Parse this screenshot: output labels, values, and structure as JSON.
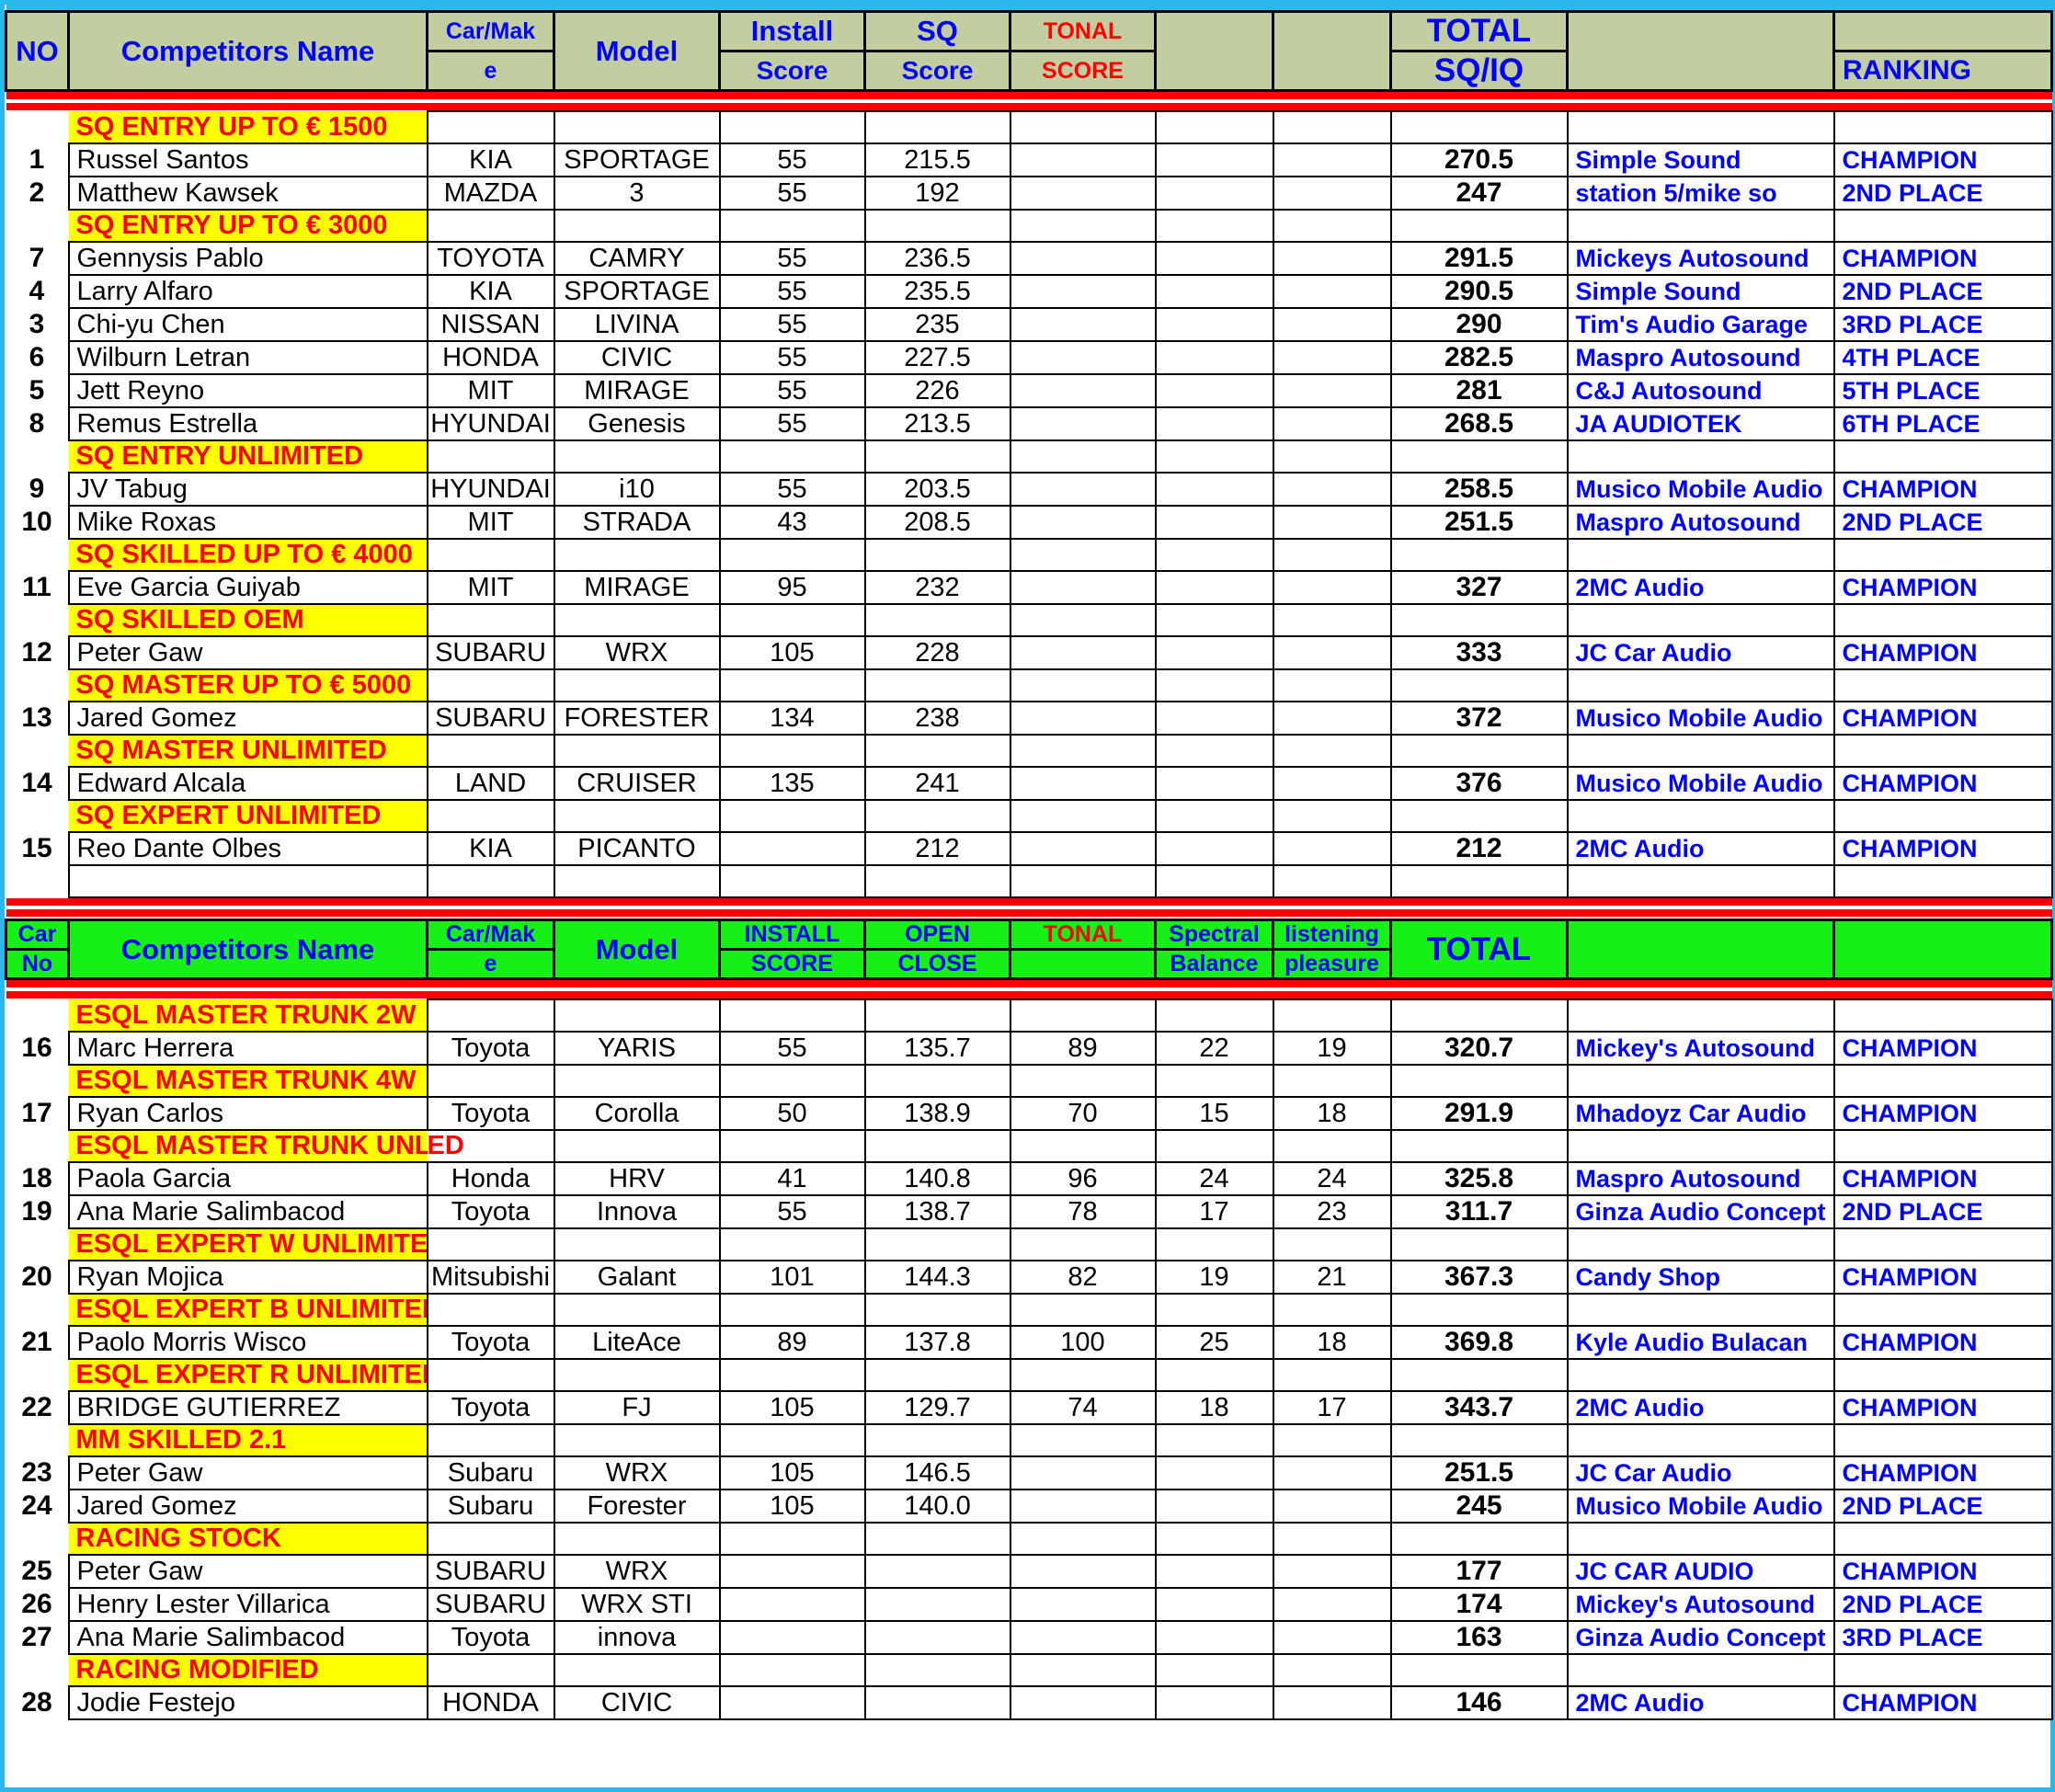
{
  "colors": {
    "sq_header_bg": "#c3cea0",
    "esql_header_bg": "#16f016",
    "category_bg": "#ffff00",
    "category_text": "#ff0000",
    "header_text": "#0000ff",
    "shop_text": "#0000ff",
    "rule": "#ff0000",
    "page_border": "#2bb8ea"
  },
  "sq_table": {
    "header": {
      "no": "NO",
      "name": "Competitors Name",
      "make_line1": "Car/Mak",
      "make_line2": "e",
      "model": "Model",
      "install_line1": "Install",
      "install_line2": "Score",
      "sq_line1": "SQ",
      "sq_line2": "Score",
      "tonal_line1": "TONAL",
      "tonal_line2": "SCORE",
      "extra1": "",
      "extra2": "",
      "total_line1": "TOTAL",
      "total_line2": "SQ/IQ",
      "shop": "",
      "ranking": "RANKING"
    },
    "rows": [
      {
        "kind": "category",
        "label": "SQ ENTRY  UP TO  € 1500"
      },
      {
        "kind": "data",
        "no": "1",
        "name": "Russel Santos",
        "make": "KIA",
        "model": "SPORTAGE",
        "install": "55",
        "sq": "215.5",
        "tonal": "",
        "x1": "",
        "x2": "",
        "total": "270.5",
        "shop": "Simple Sound",
        "rank": "CHAMPION"
      },
      {
        "kind": "data",
        "no": "2",
        "name": "Matthew Kawsek",
        "make": "MAZDA",
        "model": "3",
        "install": "55",
        "sq": "192",
        "tonal": "",
        "x1": "",
        "x2": "",
        "total": "247",
        "shop": "station 5/mike so",
        "rank": "2ND PLACE"
      },
      {
        "kind": "category",
        "label": "SQ ENTRY  UP TO  € 3000"
      },
      {
        "kind": "data",
        "no": "7",
        "name": "Gennysis Pablo",
        "make": "TOYOTA",
        "model": "CAMRY",
        "install": "55",
        "sq": "236.5",
        "tonal": "",
        "x1": "",
        "x2": "",
        "total": "291.5",
        "shop": "Mickeys Autosound",
        "rank": "CHAMPION"
      },
      {
        "kind": "data",
        "no": "4",
        "name": "Larry Alfaro",
        "make": "KIA",
        "model": "SPORTAGE",
        "install": "55",
        "sq": "235.5",
        "tonal": "",
        "x1": "",
        "x2": "",
        "total": "290.5",
        "shop": "Simple Sound",
        "rank": "2ND PLACE"
      },
      {
        "kind": "data",
        "no": "3",
        "name": "Chi-yu Chen",
        "make": "NISSAN",
        "model": "LIVINA",
        "install": "55",
        "sq": "235",
        "tonal": "",
        "x1": "",
        "x2": "",
        "total": "290",
        "shop": "Tim's Audio Garage",
        "rank": "3RD PLACE"
      },
      {
        "kind": "data",
        "no": "6",
        "name": "Wilburn Letran",
        "make": "HONDA",
        "model": "CIVIC",
        "install": "55",
        "sq": "227.5",
        "tonal": "",
        "x1": "",
        "x2": "",
        "total": "282.5",
        "shop": "Maspro Autosound",
        "rank": "4TH PLACE"
      },
      {
        "kind": "data",
        "no": "5",
        "name": "Jett Reyno",
        "make": "MIT",
        "model": "MIRAGE",
        "install": "55",
        "sq": "226",
        "tonal": "",
        "x1": "",
        "x2": "",
        "total": "281",
        "shop": "C&J Autosound",
        "rank": "5TH PLACE"
      },
      {
        "kind": "data",
        "no": "8",
        "name": "Remus Estrella",
        "make": "HYUNDAI",
        "model": "Genesis",
        "install": "55",
        "sq": "213.5",
        "tonal": "",
        "x1": "",
        "x2": "",
        "total": "268.5",
        "shop": "JA AUDIOTEK",
        "rank": "6TH PLACE"
      },
      {
        "kind": "category",
        "label": "SQ ENTRY  UNLIMITED"
      },
      {
        "kind": "data",
        "no": "9",
        "name": "JV Tabug",
        "make": "HYUNDAI",
        "model": "i10",
        "install": "55",
        "sq": "203.5",
        "tonal": "",
        "x1": "",
        "x2": "",
        "total": "258.5",
        "shop": "Musico Mobile Audio",
        "rank": "CHAMPION"
      },
      {
        "kind": "data",
        "no": "10",
        "name": "Mike Roxas",
        "make": "MIT",
        "model": "STRADA",
        "install": "43",
        "sq": "208.5",
        "tonal": "",
        "x1": "",
        "x2": "",
        "total": "251.5",
        "shop": "Maspro Autosound",
        "rank": "2ND PLACE"
      },
      {
        "kind": "category",
        "label": "SQ SKILLED  UP TO  € 4000"
      },
      {
        "kind": "data",
        "no": "11",
        "name": "Eve Garcia Guiyab",
        "make": "MIT",
        "model": "MIRAGE",
        "install": "95",
        "sq": "232",
        "tonal": "",
        "x1": "",
        "x2": "",
        "total": "327",
        "shop": "2MC Audio",
        "rank": "CHAMPION"
      },
      {
        "kind": "category",
        "label": "SQ SKILLED  OEM"
      },
      {
        "kind": "data",
        "no": "12",
        "name": "Peter Gaw",
        "make": "SUBARU",
        "model": "WRX",
        "install": "105",
        "sq": "228",
        "tonal": "",
        "x1": "",
        "x2": "",
        "total": "333",
        "shop": "JC Car Audio",
        "rank": "CHAMPION"
      },
      {
        "kind": "category",
        "label": "SQ MASTER UP TO € 5000"
      },
      {
        "kind": "data",
        "no": "13",
        "name": "Jared Gomez",
        "make": "SUBARU",
        "model": "FORESTER",
        "install": "134",
        "sq": "238",
        "tonal": "",
        "x1": "",
        "x2": "",
        "total": "372",
        "shop": "Musico Mobile Audio",
        "rank": "CHAMPION"
      },
      {
        "kind": "category",
        "label": "SQ MASTER  UNLIMITED"
      },
      {
        "kind": "data",
        "no": "14",
        "name": "Edward Alcala",
        "make": "LAND",
        "model": "CRUISER",
        "install": "135",
        "sq": "241",
        "tonal": "",
        "x1": "",
        "x2": "",
        "total": "376",
        "shop": "Musico Mobile Audio",
        "rank": "CHAMPION"
      },
      {
        "kind": "category",
        "label": "SQ EXPERT UNLIMITED"
      },
      {
        "kind": "data",
        "no": "15",
        "name": "Reo Dante Olbes",
        "make": "KIA",
        "model": "PICANTO",
        "install": "",
        "sq": "212",
        "tonal": "",
        "x1": "",
        "x2": "",
        "total": "212",
        "shop": "2MC Audio",
        "rank": "CHAMPION"
      },
      {
        "kind": "spacer"
      }
    ]
  },
  "esql_table": {
    "header": {
      "no_line1": "Car",
      "no_line2": "No",
      "name": "Competitors Name",
      "make_line1": "Car/Mak",
      "make_line2": "e",
      "model": "Model",
      "install_line1": "INSTALL",
      "install_line2": "SCORE",
      "open_line1": "OPEN",
      "open_line2": "CLOSE",
      "tonal_line1": "TONAL",
      "tonal_line2": "",
      "spectral_line1": "Spectral",
      "spectral_line2": "Balance",
      "listening_line1": "listening",
      "listening_line2": "pleasure",
      "total": "TOTAL",
      "shop": "",
      "ranking": ""
    },
    "rows": [
      {
        "kind": "category",
        "label": "ESQL MASTER TRUNK 2W"
      },
      {
        "kind": "data",
        "no": "16",
        "name": "Marc Herrera",
        "make": "Toyota",
        "model": "YARIS",
        "install": "55",
        "open": "135.7",
        "tonal": "89",
        "spectral": "22",
        "listening": "19",
        "total": "320.7",
        "shop": "Mickey's Autosound",
        "rank": "CHAMPION"
      },
      {
        "kind": "category",
        "label": "ESQL MASTER TRUNK 4W"
      },
      {
        "kind": "data",
        "no": "17",
        "name": "Ryan Carlos",
        "make": "Toyota",
        "model": "Corolla",
        "install": "50",
        "open": "138.9",
        "tonal": "70",
        "spectral": "15",
        "listening": "18",
        "total": "291.9",
        "shop": "Mhadoyz Car Audio",
        "rank": "CHAMPION"
      },
      {
        "kind": "category_overflow",
        "label": "ESQL MASTER TRUNK UNLIMITED",
        "visible_in_cell": "ESQL MASTER TRUNK UNLIMIT",
        "overflow": "ED"
      },
      {
        "kind": "data",
        "no": "18",
        "name": "Paola Garcia",
        "make": "Honda",
        "model": "HRV",
        "install": "41",
        "open": "140.8",
        "tonal": "96",
        "spectral": "24",
        "listening": "24",
        "total": "325.8",
        "shop": "Maspro Autosound",
        "rank": "CHAMPION"
      },
      {
        "kind": "data",
        "no": "19",
        "name": "Ana Marie Salimbacod",
        "make": "Toyota",
        "model": "Innova",
        "install": "55",
        "open": "138.7",
        "tonal": "78",
        "spectral": "17",
        "listening": "23",
        "total": "311.7",
        "shop": "Ginza Audio Concept",
        "rank": "2ND PLACE"
      },
      {
        "kind": "category",
        "label": "ESQL EXPERT W UNLIMITED"
      },
      {
        "kind": "data",
        "no": "20",
        "name": "Ryan Mojica",
        "make": "Mitsubishi",
        "model": "Galant",
        "install": "101",
        "open": "144.3",
        "tonal": "82",
        "spectral": "19",
        "listening": "21",
        "total": "367.3",
        "shop": "Candy Shop",
        "rank": "CHAMPION"
      },
      {
        "kind": "category",
        "label": "ESQL EXPERT B UNLIMITED"
      },
      {
        "kind": "data",
        "no": "21",
        "name": "Paolo Morris Wisco",
        "make": "Toyota",
        "model": "LiteAce",
        "install": "89",
        "open": "137.8",
        "tonal": "100",
        "spectral": "25",
        "listening": "18",
        "total": "369.8",
        "shop": "Kyle Audio Bulacan",
        "rank": "CHAMPION"
      },
      {
        "kind": "category",
        "label": "ESQL EXPERT R UNLIMITED"
      },
      {
        "kind": "data",
        "no": "22",
        "name": "BRIDGE GUTIERREZ",
        "make": "Toyota",
        "model": "FJ",
        "install": "105",
        "open": "129.7",
        "tonal": "74",
        "spectral": "18",
        "listening": "17",
        "total": "343.7",
        "shop": "2MC Audio",
        "rank": "CHAMPION"
      },
      {
        "kind": "category",
        "label": "MM SKILLED 2.1"
      },
      {
        "kind": "data",
        "no": "23",
        "name": "Peter Gaw",
        "make": "Subaru",
        "model": "WRX",
        "install": "105",
        "open": "146.5",
        "tonal": "",
        "spectral": "",
        "listening": "",
        "total": "251.5",
        "shop": "JC Car Audio",
        "rank": "CHAMPION"
      },
      {
        "kind": "data",
        "no": "24",
        "name": "Jared Gomez",
        "make": "Subaru",
        "model": "Forester",
        "install": "105",
        "open": "140.0",
        "tonal": "",
        "spectral": "",
        "listening": "",
        "total": "245",
        "shop": "Musico Mobile Audio",
        "rank": "2ND PLACE"
      },
      {
        "kind": "category",
        "label": "RACING STOCK"
      },
      {
        "kind": "data",
        "no": "25",
        "name": "Peter Gaw",
        "make": "SUBARU",
        "model": "WRX",
        "install": "",
        "open": "",
        "tonal": "",
        "spectral": "",
        "listening": "",
        "total": "177",
        "shop": "JC CAR AUDIO",
        "rank": "CHAMPION"
      },
      {
        "kind": "data",
        "no": "26",
        "name": "Henry Lester Villarica",
        "make": "SUBARU",
        "model": "WRX STI",
        "install": "",
        "open": "",
        "tonal": "",
        "spectral": "",
        "listening": "",
        "total": "174",
        "shop": "Mickey's Autosound",
        "rank": "2ND PLACE"
      },
      {
        "kind": "data",
        "no": "27",
        "name": "Ana Marie Salimbacod",
        "make": "Toyota",
        "model": "innova",
        "install": "",
        "open": "",
        "tonal": "",
        "spectral": "",
        "listening": "",
        "total": "163",
        "shop": "Ginza Audio Concept",
        "rank": "3RD PLACE"
      },
      {
        "kind": "category",
        "label": "RACING MODIFIED"
      },
      {
        "kind": "data",
        "no": "28",
        "name": "Jodie Festejo",
        "make": "HONDA",
        "model": "CIVIC",
        "install": "",
        "open": "",
        "tonal": "",
        "spectral": "",
        "listening": "",
        "total": "146",
        "shop": "2MC Audio",
        "rank": "CHAMPION"
      }
    ]
  }
}
